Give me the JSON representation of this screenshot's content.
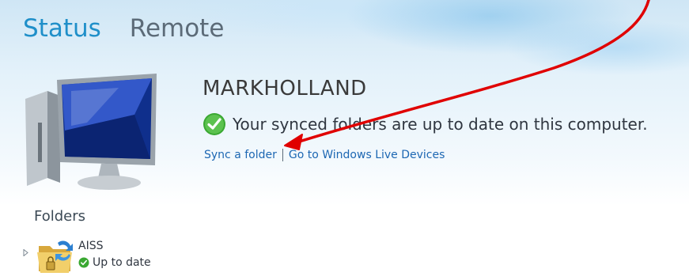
{
  "tabs": [
    {
      "label": "Status",
      "active": true
    },
    {
      "label": "Remote",
      "active": false
    }
  ],
  "device": {
    "name": "MARKHOLLAND",
    "status_message": "Your synced folders are up to date on this computer.",
    "status_icon": "check-circle-icon"
  },
  "links": {
    "sync_folder": "Sync a folder",
    "go_to_devices": "Go to Windows Live Devices"
  },
  "folders": {
    "title": "Folders",
    "items": [
      {
        "name": "AISS",
        "status": "Up to date"
      }
    ]
  },
  "colors": {
    "accent": "#1f8fc9",
    "link": "#1d67b3",
    "check_green": "#3aa832",
    "annotation_arrow": "#e00000"
  }
}
